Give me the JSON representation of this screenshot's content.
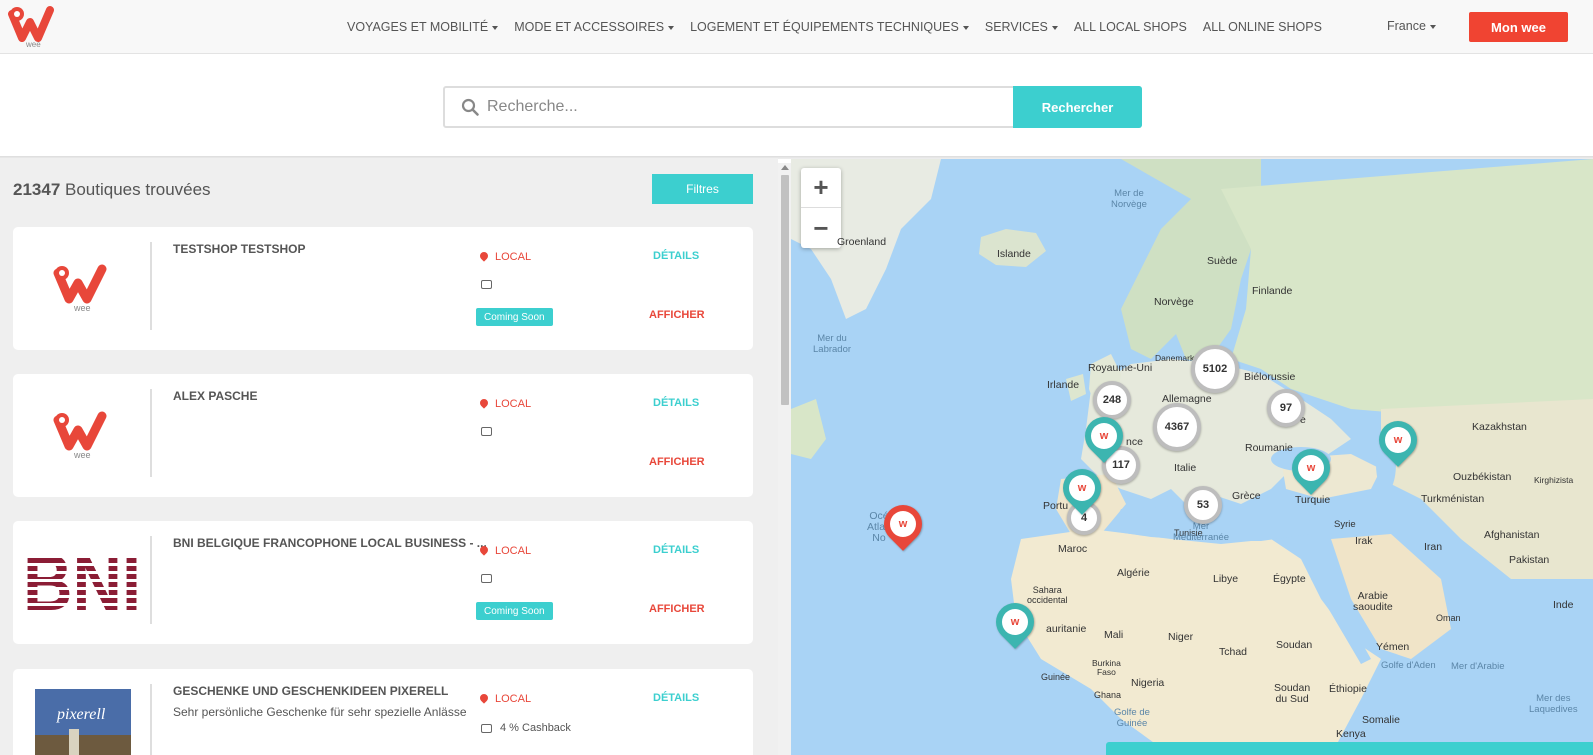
{
  "brand": {
    "logo_text": "wee",
    "accent": "#3ccfcf",
    "primary_red": "#f04432"
  },
  "nav": {
    "items": [
      {
        "label": "VOYAGES ET MOBILITÉ",
        "dropdown": true
      },
      {
        "label": "MODE ET ACCESSOIRES",
        "dropdown": true
      },
      {
        "label": "LOGEMENT ET ÉQUIPEMENTS TECHNIQUES",
        "dropdown": true
      },
      {
        "label": "SERVICES",
        "dropdown": true
      },
      {
        "label": "ALL LOCAL SHOPS",
        "dropdown": false
      },
      {
        "label": "ALL ONLINE SHOPS",
        "dropdown": false
      }
    ],
    "country": "France",
    "account_button": "Mon wee"
  },
  "search": {
    "placeholder": "Recherche...",
    "button": "Rechercher"
  },
  "results": {
    "count": "21347",
    "count_suffix": "Boutiques trouvées",
    "filters_button": "Filtres"
  },
  "shops": [
    {
      "name": "TESTSHOP TESTSHOP",
      "description": "",
      "type": "LOCAL",
      "cashback": "",
      "coming_soon": "Coming Soon",
      "details": "DÉTAILS",
      "afficher": "AFFICHER",
      "logo": "wee"
    },
    {
      "name": "ALEX PASCHE",
      "description": "",
      "type": "LOCAL",
      "cashback": "",
      "coming_soon": "",
      "details": "DÉTAILS",
      "afficher": "AFFICHER",
      "logo": "wee"
    },
    {
      "name": "BNI BELGIQUE FRANCOPHONE LOCAL BUSINESS - ...",
      "description": "",
      "type": "LOCAL",
      "cashback": "",
      "coming_soon": "Coming Soon",
      "details": "DÉTAILS",
      "afficher": "AFFICHER",
      "logo": "BNI"
    },
    {
      "name": "GESCHENKE UND GESCHENKIDEEN PIXERELL",
      "description": "Sehr persönliche Geschenke für sehr spezielle Anlässe",
      "type": "LOCAL",
      "cashback": "4 % Cashback",
      "coming_soon": "",
      "details": "DÉTAILS",
      "afficher": "",
      "logo": "pixerell"
    }
  ],
  "map": {
    "zoom_in": "+",
    "zoom_out": "−",
    "labels": {
      "groenland": "Groenland",
      "islande": "Islande",
      "suede": "Suède",
      "finlande": "Finlande",
      "norvege": "Norvège",
      "royaume_uni": "Royaume-Uni",
      "irlande": "Irlande",
      "danemark": "Danemark",
      "allemagne": "Allemagne",
      "bielorussie": "Biélorussie",
      "roumanie": "Roumanie",
      "italie": "Italie",
      "france": "nce",
      "portugal": "Portu",
      "grece": "Grèce",
      "turquie": "Turquie",
      "tunisie": "Tunisie",
      "maroc": "Maroc",
      "algerie": "Algérie",
      "libye": "Libye",
      "egypte": "Égypte",
      "syrie": "Syrie",
      "irak": "Irak",
      "iran": "Iran",
      "afghanistan": "Afghanistan",
      "pakistan": "Pakistan",
      "kazakhstan": "Kazakhstan",
      "ouzbekistan": "Ouzbékistan",
      "kirghizistan": "Kirghizista",
      "turkmenistan": "Turkménistan",
      "arabie": "Arabie\nsaoudite",
      "oman": "Oman",
      "yemen": "Yémen",
      "soudan": "Soudan",
      "soudan_sud": "Soudan\ndu Sud",
      "ethiopie": "Éthiopie",
      "somalie": "Somalie",
      "kenya": "Kenya",
      "tchad": "Tchad",
      "niger": "Niger",
      "mali": "Mali",
      "nigeria": "Nigeria",
      "mauritanie": "auritanie",
      "sahara": "Sahara\noccidental",
      "guinee": "Guinée",
      "ghana": "Ghana",
      "burkina": "Burkina\nFaso",
      "inde": "Inde",
      "ukraine": "e"
    },
    "seas": {
      "norvege": "Mer de\nNorvège",
      "labrador": "Mer du\nLabrador",
      "mediterranee": "Mer\nMéditerranée",
      "arabie": "Mer d'Arabie",
      "aden": "Golfe d'Aden",
      "guinee": "Golfe de\nGuinée",
      "laquedives": "Mer des\nLaquedives",
      "atlantique": "Océ\nAtlan\nNo"
    },
    "clusters": [
      "5102",
      "248",
      "4367",
      "97",
      "117",
      "53",
      "4"
    ]
  }
}
